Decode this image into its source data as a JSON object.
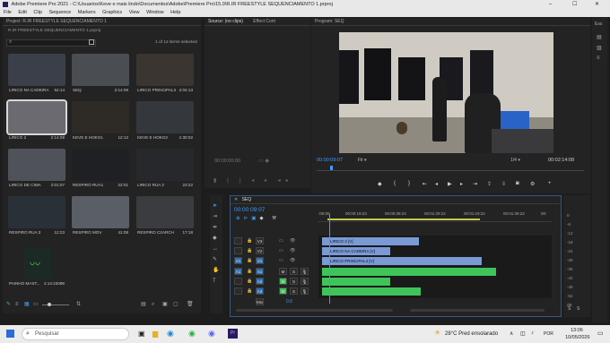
{
  "window": {
    "title": "Adobe Premiere Pro 2021 - C:\\Usuarios\\Keve e mais lindo\\Documentos\\Adobe\\Premiere Pro\\15.0\\R.IR FREESTYLE SEQUENCIAMENTO 1.prproj",
    "minimize": "–",
    "maximize": "☐",
    "close": "✕"
  },
  "menu": [
    "File",
    "Edit",
    "Clip",
    "Sequence",
    "Markers",
    "Graphics",
    "View",
    "Window",
    "Help"
  ],
  "project": {
    "tab": "Project: R.IR FREESTYLE SEQUENCIAMENTO 1",
    "path": "R.IR FREESTYLE SEQUENCIAMENTO 1.prproj",
    "items_selected": "1 of 12 items selected",
    "search_icon": "search-icon",
    "items": [
      {
        "name": "LIRICO NA CADEIRA",
        "duration": "54:14",
        "color": "#3b3f4a"
      },
      {
        "name": "SEQ",
        "duration": "2:14:08",
        "color": "#4a4d52"
      },
      {
        "name": "LIRICO PRINCIPAL3",
        "duration": "2:04:13",
        "color": "#3a3530"
      },
      {
        "name": "LIRICO 2",
        "duration": "2:14:09",
        "color": "#6a6a70"
      },
      {
        "name": "KEVE E HOKG1",
        "duration": "12:12",
        "color": "#2e2a26"
      },
      {
        "name": "KEVE E HOKG2",
        "duration": "1:30:02",
        "color": "#34383c"
      },
      {
        "name": "LIRICO DE CIMA",
        "duration": "2:01:07",
        "color": "#50525a"
      },
      {
        "name": "RESPIRO RUA1",
        "duration": "22:01",
        "color": "#1e2024"
      },
      {
        "name": "LIRICO RUA 2",
        "duration": "23:22",
        "color": "#26282c"
      },
      {
        "name": "RESPIRO RUA 3",
        "duration": "12:23",
        "color": "#2a3038"
      },
      {
        "name": "RESPIRO MOV",
        "duration": "41:08",
        "color": "#5a5e66"
      },
      {
        "name": "RESPIRO C2ARCH",
        "duration": "17:18",
        "color": "#3a3c40"
      },
      {
        "name": "PAINHO MAST...",
        "duration": "2:14:23098",
        "color": "#1c2a25"
      }
    ]
  },
  "source": {
    "tab": "Source: (no clips)",
    "tab2": "Effect Cont",
    "timecode": "00:00:00:00"
  },
  "program": {
    "tab": "Program: SEQ",
    "timecode": "00:00:09:07",
    "fit": "Fit",
    "scale": "1/4",
    "duration": "00:02:14:08"
  },
  "timeline": {
    "tab": "SEQ",
    "timecode": "00:00:09:07",
    "ruler": [
      ":00:00",
      "00:00:19:23",
      "00:00:39:23",
      "00:01:29:22",
      "00:01:19:22",
      "00:01:39:22",
      "00:"
    ],
    "tracks": [
      {
        "id": "V3",
        "label": "V3"
      },
      {
        "id": "V2",
        "label": "V2"
      },
      {
        "id": "V1",
        "label": "V1"
      },
      {
        "id": "A1",
        "label": "A1"
      },
      {
        "id": "A2",
        "label": "A2"
      },
      {
        "id": "A3",
        "label": "A3"
      },
      {
        "id": "Mix",
        "label": "Mix",
        "value": "0.0"
      }
    ],
    "clips": {
      "v3": "LIRICO 2 [V]",
      "v2": "LIRICO NA CADEIRA [V]",
      "v1": "LIRICO PRINCIPAL3 [V]"
    },
    "meter_labels": [
      "0",
      "-6",
      "-12",
      "-18",
      "-24",
      "-30",
      "-36",
      "-42",
      "-48",
      "-54",
      "dB"
    ],
    "meter_footer": [
      "S",
      "S"
    ]
  },
  "taskbar": {
    "search_placeholder": "Pesquisar",
    "weather": "28°C Pred ensolarado",
    "time": "13:06",
    "date": "10/05/2026",
    "lang": "POR"
  }
}
